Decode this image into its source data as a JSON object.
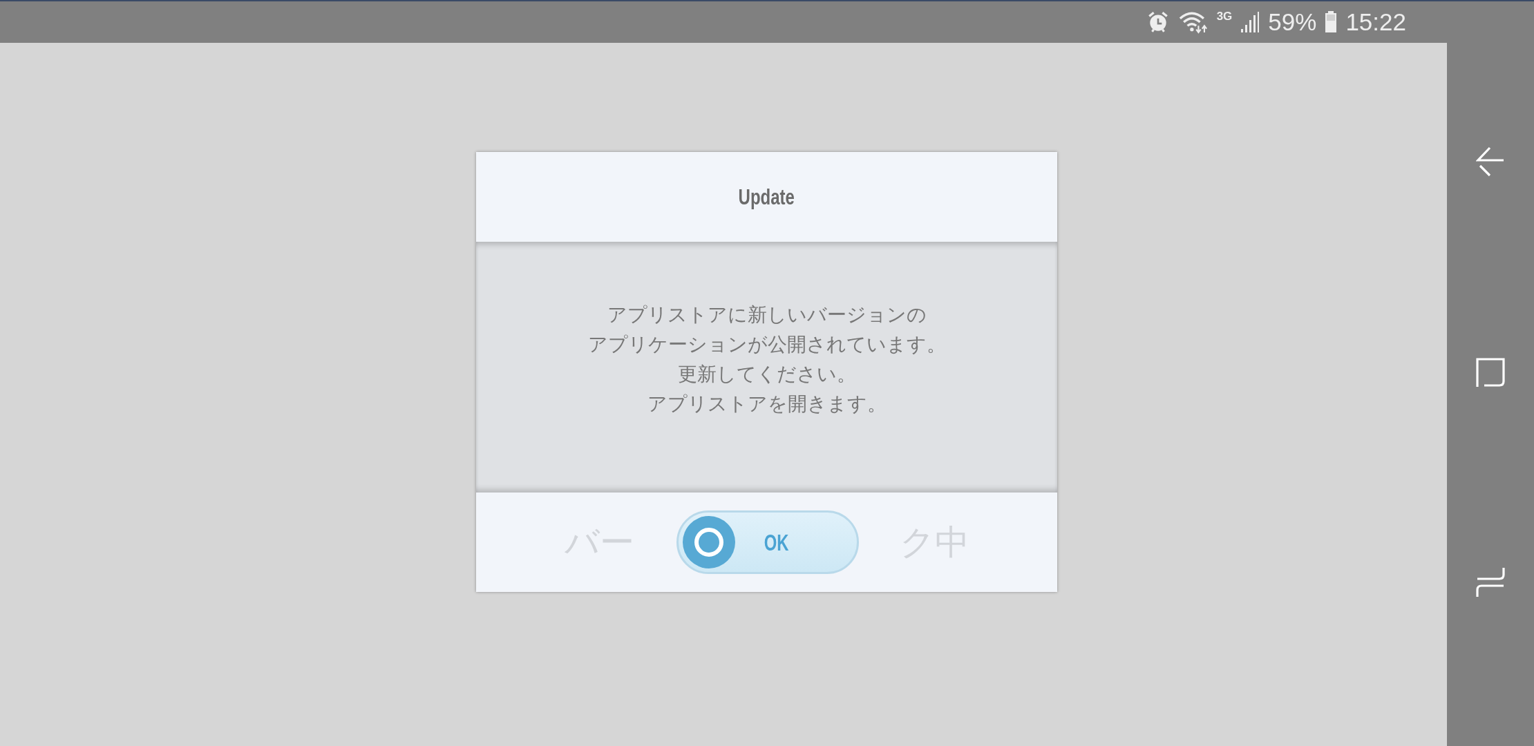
{
  "status_bar": {
    "network": "3G",
    "battery": "59%",
    "time": "15:22"
  },
  "dialog": {
    "title": "Update",
    "message_lines": [
      "アプリストアに新しいバージョンの",
      "アプリケーションが公開されています。",
      "更新してください。",
      "アプリストアを開きます。"
    ],
    "background_text": [
      "バー",
      "ク中"
    ],
    "ok_button": {
      "label": "OK"
    }
  }
}
